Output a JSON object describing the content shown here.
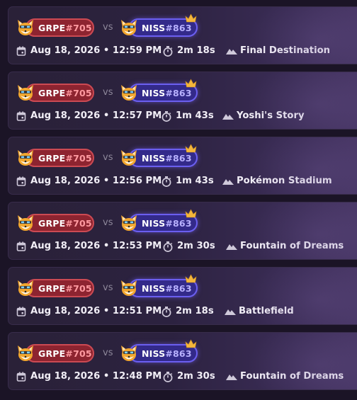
{
  "vs_label": "vs",
  "colors": {
    "p1_pill": "#8d2430",
    "p1_tag": "#ff9aa0",
    "p2_pill": "#332a8a",
    "p2_tag": "#b9b2ff",
    "crown": "#f5b73c"
  },
  "icons": {
    "date": "calendar-icon",
    "duration": "stopwatch-icon",
    "stage": "mountain-icon",
    "winner": "crown-icon",
    "character": "fox-character-icon"
  },
  "matches": [
    {
      "player1": {
        "name": "GRPE",
        "tag": "#705"
      },
      "player2": {
        "name": "NISS",
        "tag": "#863",
        "winner": true
      },
      "datetime": "Aug 18, 2026 • 12:59 PM",
      "duration": "2m 18s",
      "stage": "Final Destination"
    },
    {
      "player1": {
        "name": "GRPE",
        "tag": "#705"
      },
      "player2": {
        "name": "NISS",
        "tag": "#863",
        "winner": true
      },
      "datetime": "Aug 18, 2026 • 12:57 PM",
      "duration": "1m 43s",
      "stage": "Yoshi's Story"
    },
    {
      "player1": {
        "name": "GRPE",
        "tag": "#705"
      },
      "player2": {
        "name": "NISS",
        "tag": "#863",
        "winner": true
      },
      "datetime": "Aug 18, 2026 • 12:56 PM",
      "duration": "1m 43s",
      "stage": "Pokémon Stadium"
    },
    {
      "player1": {
        "name": "GRPE",
        "tag": "#705"
      },
      "player2": {
        "name": "NISS",
        "tag": "#863",
        "winner": true
      },
      "datetime": "Aug 18, 2026 • 12:53 PM",
      "duration": "2m 30s",
      "stage": "Fountain of Dreams"
    },
    {
      "player1": {
        "name": "GRPE",
        "tag": "#705"
      },
      "player2": {
        "name": "NISS",
        "tag": "#863",
        "winner": true
      },
      "datetime": "Aug 18, 2026 • 12:51 PM",
      "duration": "2m 18s",
      "stage": "Battlefield"
    },
    {
      "player1": {
        "name": "GRPE",
        "tag": "#705"
      },
      "player2": {
        "name": "NISS",
        "tag": "#863",
        "winner": true
      },
      "datetime": "Aug 18, 2026 • 12:48 PM",
      "duration": "2m 30s",
      "stage": "Fountain of Dreams"
    }
  ]
}
